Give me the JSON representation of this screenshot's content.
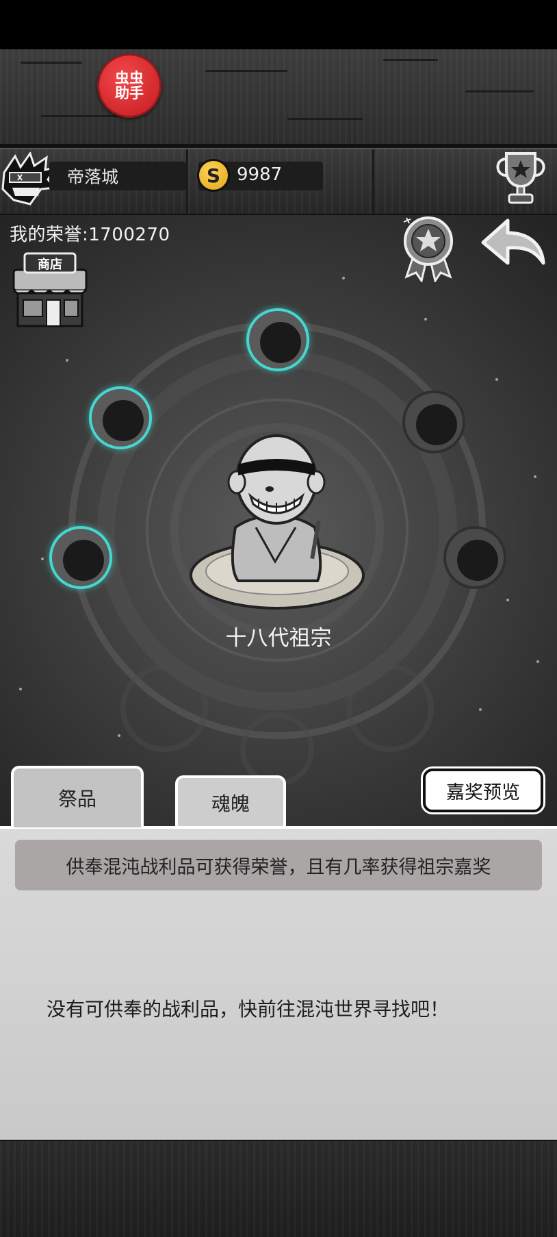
{
  "helper_button": {
    "label": "虫虫\n助手"
  },
  "header": {
    "city_name": "帝落城",
    "coin_symbol": "S",
    "coins": "9987"
  },
  "honor": {
    "text": "我的荣誉:1700270"
  },
  "shop": {
    "sign": "商店"
  },
  "ancestor": {
    "name": "十八代祖宗"
  },
  "slots": [
    {
      "state": "active"
    },
    {
      "state": "active"
    },
    {
      "state": "inactive"
    },
    {
      "state": "active"
    },
    {
      "state": "inactive"
    }
  ],
  "tabs": [
    {
      "label": "祭品",
      "selected": true
    },
    {
      "label": "魂魄",
      "selected": false
    }
  ],
  "reward_preview": {
    "label": "嘉奖预览"
  },
  "panel": {
    "banner": "供奉混沌战利品可获得荣誉，且有几率获得祖宗嘉奖",
    "empty_message": "没有可供奉的战利品，快前往混沌世界寻找吧！"
  },
  "colors": {
    "slot_active_ring": "#46d7d0",
    "helper_red": "#d8262a",
    "coin_gold": "#f0b82a"
  }
}
